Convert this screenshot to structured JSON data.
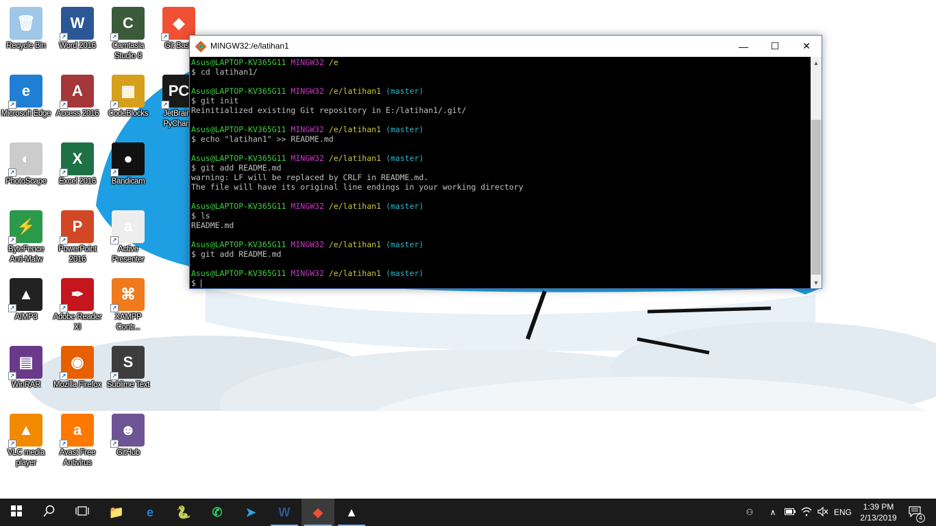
{
  "desktop": {
    "icons": [
      {
        "label": "Recycle Bin",
        "color": "#9fc7e8",
        "glyph": "🗑",
        "shortcut": false
      },
      {
        "label": "Word 2016",
        "color": "#2b5797",
        "glyph": "W",
        "shortcut": true
      },
      {
        "label": "Camtasia Studio 8",
        "color": "#3a5a3a",
        "glyph": "C",
        "shortcut": true
      },
      {
        "label": "Git Bash",
        "color": "#f05033",
        "glyph": "◆",
        "shortcut": true
      },
      {
        "label": "Microsoft Edge",
        "color": "#1e7fd4",
        "glyph": "e",
        "shortcut": true
      },
      {
        "label": "Access 2016",
        "color": "#a4373a",
        "glyph": "A",
        "shortcut": true
      },
      {
        "label": "CodeBlocks",
        "color": "#d6a01c",
        "glyph": "▦",
        "shortcut": true
      },
      {
        "label": "JetBrains PyCharm",
        "color": "#1a1a1a",
        "glyph": "PC",
        "shortcut": true
      },
      {
        "label": "PhotoScape",
        "color": "#cccccc",
        "glyph": "◐",
        "shortcut": true
      },
      {
        "label": "Excel 2016",
        "color": "#1e7145",
        "glyph": "X",
        "shortcut": true
      },
      {
        "label": "Bandicam",
        "color": "#111111",
        "glyph": "●",
        "shortcut": true
      },
      {
        "label": "ByteFence Anti-Malw",
        "color": "#2a9a4a",
        "glyph": "⚡",
        "shortcut": true
      },
      {
        "label": "PowerPoint 2016",
        "color": "#d24726",
        "glyph": "P",
        "shortcut": true
      },
      {
        "label": "Active Presenter",
        "color": "#eeeeee",
        "glyph": "a",
        "shortcut": true
      },
      {
        "label": "AIMP3",
        "color": "#222222",
        "glyph": "▲",
        "shortcut": true
      },
      {
        "label": "Adobe Reader XI",
        "color": "#c4161c",
        "glyph": "✒",
        "shortcut": true
      },
      {
        "label": "XAMPP Contr...",
        "color": "#f07b1f",
        "glyph": "⌘",
        "shortcut": true
      },
      {
        "label": "WinRAR",
        "color": "#6a3a8a",
        "glyph": "▤",
        "shortcut": true
      },
      {
        "label": "Mozilla Firefox",
        "color": "#e66000",
        "glyph": "◉",
        "shortcut": true
      },
      {
        "label": "Sublime Text",
        "color": "#3d3d3d",
        "glyph": "S",
        "shortcut": true
      },
      {
        "label": "VLC media player",
        "color": "#f28a00",
        "glyph": "▲",
        "shortcut": true
      },
      {
        "label": "Avast Free Antivirus",
        "color": "#ff7800",
        "glyph": "a",
        "shortcut": true
      },
      {
        "label": "GitHub",
        "color": "#6e5494",
        "glyph": "☻",
        "shortcut": true
      }
    ]
  },
  "window": {
    "title": "MINGW32:/e/latihan1",
    "minimize_glyph": "—",
    "maximize_glyph": "☐",
    "close_glyph": "✕"
  },
  "terminal": {
    "lines": [
      {
        "type": "prompt",
        "user": "Asus@LAPTOP-KV365G11",
        "env": "MINGW32",
        "path": "/e",
        "branch": ""
      },
      {
        "type": "text",
        "text": "$ cd latihan1/"
      },
      {
        "type": "text",
        "text": ""
      },
      {
        "type": "prompt",
        "user": "Asus@LAPTOP-KV365G11",
        "env": "MINGW32",
        "path": "/e/latihan1",
        "branch": "(master)"
      },
      {
        "type": "text",
        "text": "$ git init"
      },
      {
        "type": "text",
        "text": "Reinitialized existing Git repository in E:/latihan1/.git/"
      },
      {
        "type": "text",
        "text": ""
      },
      {
        "type": "prompt",
        "user": "Asus@LAPTOP-KV365G11",
        "env": "MINGW32",
        "path": "/e/latihan1",
        "branch": "(master)"
      },
      {
        "type": "text",
        "text": "$ echo \"latihan1\" >> README.md"
      },
      {
        "type": "text",
        "text": ""
      },
      {
        "type": "prompt",
        "user": "Asus@LAPTOP-KV365G11",
        "env": "MINGW32",
        "path": "/e/latihan1",
        "branch": "(master)"
      },
      {
        "type": "text",
        "text": "$ git add README.md"
      },
      {
        "type": "text",
        "text": "warning: LF will be replaced by CRLF in README.md."
      },
      {
        "type": "text",
        "text": "The file will have its original line endings in your working directory"
      },
      {
        "type": "text",
        "text": ""
      },
      {
        "type": "prompt",
        "user": "Asus@LAPTOP-KV365G11",
        "env": "MINGW32",
        "path": "/e/latihan1",
        "branch": "(master)"
      },
      {
        "type": "text",
        "text": "$ ls"
      },
      {
        "type": "text",
        "text": "README.md"
      },
      {
        "type": "text",
        "text": ""
      },
      {
        "type": "prompt",
        "user": "Asus@LAPTOP-KV365G11",
        "env": "MINGW32",
        "path": "/e/latihan1",
        "branch": "(master)"
      },
      {
        "type": "text",
        "text": "$ git add README.md"
      },
      {
        "type": "text",
        "text": ""
      },
      {
        "type": "prompt",
        "user": "Asus@LAPTOP-KV365G11",
        "env": "MINGW32",
        "path": "/e/latihan1",
        "branch": "(master)"
      },
      {
        "type": "cursor",
        "text": "$ "
      }
    ]
  },
  "taskbar": {
    "start_icon": "windows-start-icon",
    "search_icon": "search-icon",
    "task_view_icon": "task-view-icon",
    "pinned": [
      {
        "name": "file-explorer",
        "glyph": "📁",
        "color": "#f3c542",
        "state": "normal"
      },
      {
        "name": "edge",
        "glyph": "e",
        "color": "#1e7fd4",
        "state": "normal"
      },
      {
        "name": "python",
        "glyph": "🐍",
        "color": "#3a74a8",
        "state": "normal"
      },
      {
        "name": "whatsapp",
        "glyph": "✆",
        "color": "#25d366",
        "state": "normal"
      },
      {
        "name": "telegram",
        "glyph": "➤",
        "color": "#2ca5e0",
        "state": "normal"
      },
      {
        "name": "word",
        "glyph": "W",
        "color": "#2b5797",
        "state": "open"
      },
      {
        "name": "git-bash",
        "glyph": "◆",
        "color": "#f05033",
        "state": "active"
      },
      {
        "name": "photos",
        "glyph": "▲",
        "color": "#ffffff",
        "state": "open"
      }
    ],
    "tray": {
      "people_glyph": "⚇",
      "chevron_glyph": "∧",
      "battery_glyph": "▭",
      "wifi_glyph": "◠",
      "volume_glyph": "🔇",
      "language": "ENG",
      "time": "1:39 PM",
      "date": "2/13/2019",
      "notification_count": "4"
    }
  }
}
